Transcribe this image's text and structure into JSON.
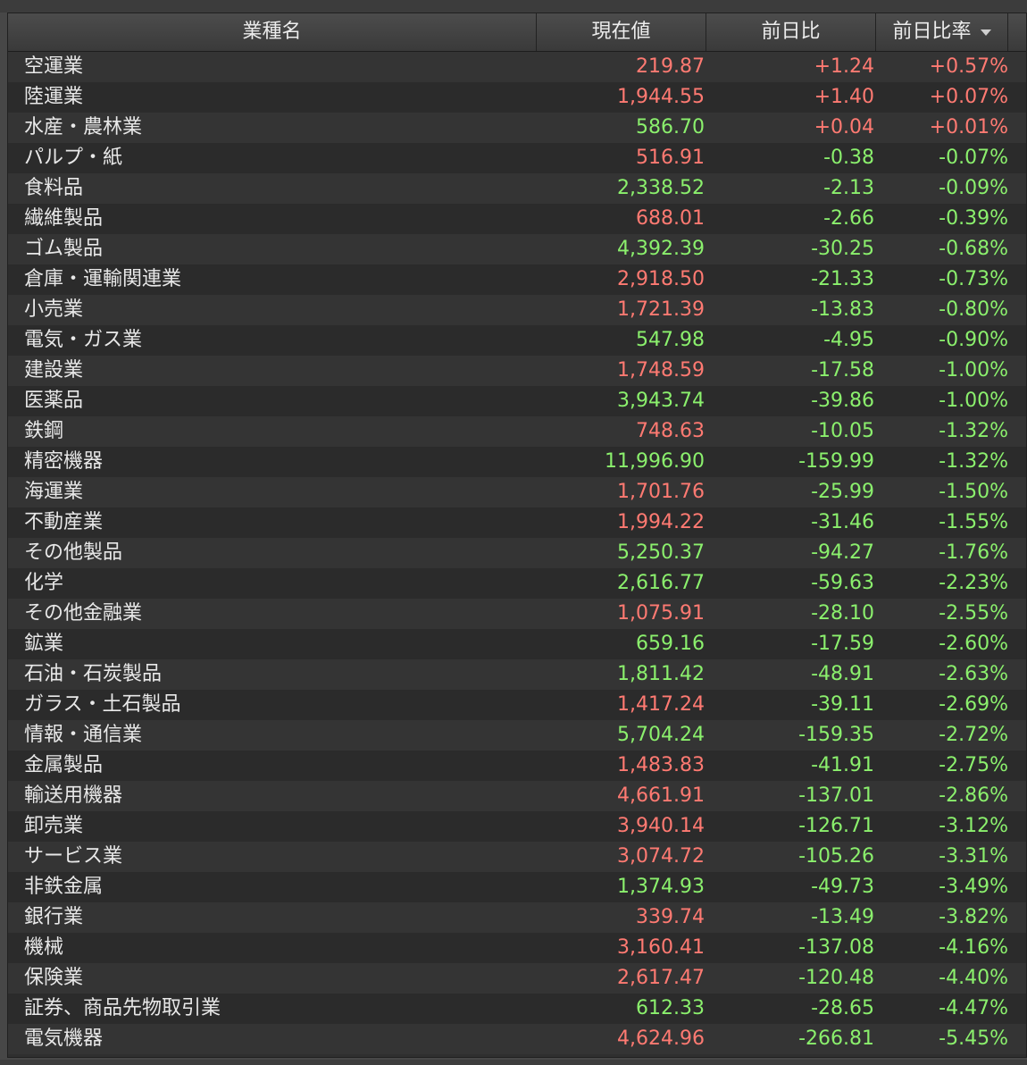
{
  "header": {
    "name": "業種名",
    "price": "現在値",
    "change": "前日比",
    "pct": "前日比率"
  },
  "colors": {
    "up": "#ff7a72",
    "down": "#8bf06d"
  },
  "rows": [
    {
      "name": "空運業",
      "price": "219.87",
      "price_dir": "up",
      "change": "+1.24",
      "pct": "+0.57%",
      "change_dir": "up"
    },
    {
      "name": "陸運業",
      "price": "1,944.55",
      "price_dir": "up",
      "change": "+1.40",
      "pct": "+0.07%",
      "change_dir": "up"
    },
    {
      "name": "水産・農林業",
      "price": "586.70",
      "price_dir": "down",
      "change": "+0.04",
      "pct": "+0.01%",
      "change_dir": "up"
    },
    {
      "name": "パルプ・紙",
      "price": "516.91",
      "price_dir": "up",
      "change": "-0.38",
      "pct": "-0.07%",
      "change_dir": "down"
    },
    {
      "name": "食料品",
      "price": "2,338.52",
      "price_dir": "down",
      "change": "-2.13",
      "pct": "-0.09%",
      "change_dir": "down"
    },
    {
      "name": "繊維製品",
      "price": "688.01",
      "price_dir": "up",
      "change": "-2.66",
      "pct": "-0.39%",
      "change_dir": "down"
    },
    {
      "name": "ゴム製品",
      "price": "4,392.39",
      "price_dir": "down",
      "change": "-30.25",
      "pct": "-0.68%",
      "change_dir": "down"
    },
    {
      "name": "倉庫・運輸関連業",
      "price": "2,918.50",
      "price_dir": "up",
      "change": "-21.33",
      "pct": "-0.73%",
      "change_dir": "down"
    },
    {
      "name": "小売業",
      "price": "1,721.39",
      "price_dir": "up",
      "change": "-13.83",
      "pct": "-0.80%",
      "change_dir": "down"
    },
    {
      "name": "電気・ガス業",
      "price": "547.98",
      "price_dir": "down",
      "change": "-4.95",
      "pct": "-0.90%",
      "change_dir": "down"
    },
    {
      "name": "建設業",
      "price": "1,748.59",
      "price_dir": "up",
      "change": "-17.58",
      "pct": "-1.00%",
      "change_dir": "down"
    },
    {
      "name": "医薬品",
      "price": "3,943.74",
      "price_dir": "down",
      "change": "-39.86",
      "pct": "-1.00%",
      "change_dir": "down"
    },
    {
      "name": "鉄鋼",
      "price": "748.63",
      "price_dir": "up",
      "change": "-10.05",
      "pct": "-1.32%",
      "change_dir": "down"
    },
    {
      "name": "精密機器",
      "price": "11,996.90",
      "price_dir": "down",
      "change": "-159.99",
      "pct": "-1.32%",
      "change_dir": "down"
    },
    {
      "name": "海運業",
      "price": "1,701.76",
      "price_dir": "up",
      "change": "-25.99",
      "pct": "-1.50%",
      "change_dir": "down"
    },
    {
      "name": "不動産業",
      "price": "1,994.22",
      "price_dir": "up",
      "change": "-31.46",
      "pct": "-1.55%",
      "change_dir": "down"
    },
    {
      "name": "その他製品",
      "price": "5,250.37",
      "price_dir": "down",
      "change": "-94.27",
      "pct": "-1.76%",
      "change_dir": "down"
    },
    {
      "name": "化学",
      "price": "2,616.77",
      "price_dir": "down",
      "change": "-59.63",
      "pct": "-2.23%",
      "change_dir": "down"
    },
    {
      "name": "その他金融業",
      "price": "1,075.91",
      "price_dir": "up",
      "change": "-28.10",
      "pct": "-2.55%",
      "change_dir": "down"
    },
    {
      "name": "鉱業",
      "price": "659.16",
      "price_dir": "down",
      "change": "-17.59",
      "pct": "-2.60%",
      "change_dir": "down"
    },
    {
      "name": "石油・石炭製品",
      "price": "1,811.42",
      "price_dir": "down",
      "change": "-48.91",
      "pct": "-2.63%",
      "change_dir": "down"
    },
    {
      "name": "ガラス・土石製品",
      "price": "1,417.24",
      "price_dir": "up",
      "change": "-39.11",
      "pct": "-2.69%",
      "change_dir": "down"
    },
    {
      "name": "情報・通信業",
      "price": "5,704.24",
      "price_dir": "down",
      "change": "-159.35",
      "pct": "-2.72%",
      "change_dir": "down"
    },
    {
      "name": "金属製品",
      "price": "1,483.83",
      "price_dir": "up",
      "change": "-41.91",
      "pct": "-2.75%",
      "change_dir": "down"
    },
    {
      "name": "輸送用機器",
      "price": "4,661.91",
      "price_dir": "up",
      "change": "-137.01",
      "pct": "-2.86%",
      "change_dir": "down"
    },
    {
      "name": "卸売業",
      "price": "3,940.14",
      "price_dir": "up",
      "change": "-126.71",
      "pct": "-3.12%",
      "change_dir": "down"
    },
    {
      "name": "サービス業",
      "price": "3,074.72",
      "price_dir": "up",
      "change": "-105.26",
      "pct": "-3.31%",
      "change_dir": "down"
    },
    {
      "name": "非鉄金属",
      "price": "1,374.93",
      "price_dir": "down",
      "change": "-49.73",
      "pct": "-3.49%",
      "change_dir": "down"
    },
    {
      "name": "銀行業",
      "price": "339.74",
      "price_dir": "up",
      "change": "-13.49",
      "pct": "-3.82%",
      "change_dir": "down"
    },
    {
      "name": "機械",
      "price": "3,160.41",
      "price_dir": "up",
      "change": "-137.08",
      "pct": "-4.16%",
      "change_dir": "down"
    },
    {
      "name": "保険業",
      "price": "2,617.47",
      "price_dir": "up",
      "change": "-120.48",
      "pct": "-4.40%",
      "change_dir": "down"
    },
    {
      "name": "証券、商品先物取引業",
      "price": "612.33",
      "price_dir": "down",
      "change": "-28.65",
      "pct": "-4.47%",
      "change_dir": "down"
    },
    {
      "name": "電気機器",
      "price": "4,624.96",
      "price_dir": "up",
      "change": "-266.81",
      "pct": "-5.45%",
      "change_dir": "down"
    }
  ]
}
